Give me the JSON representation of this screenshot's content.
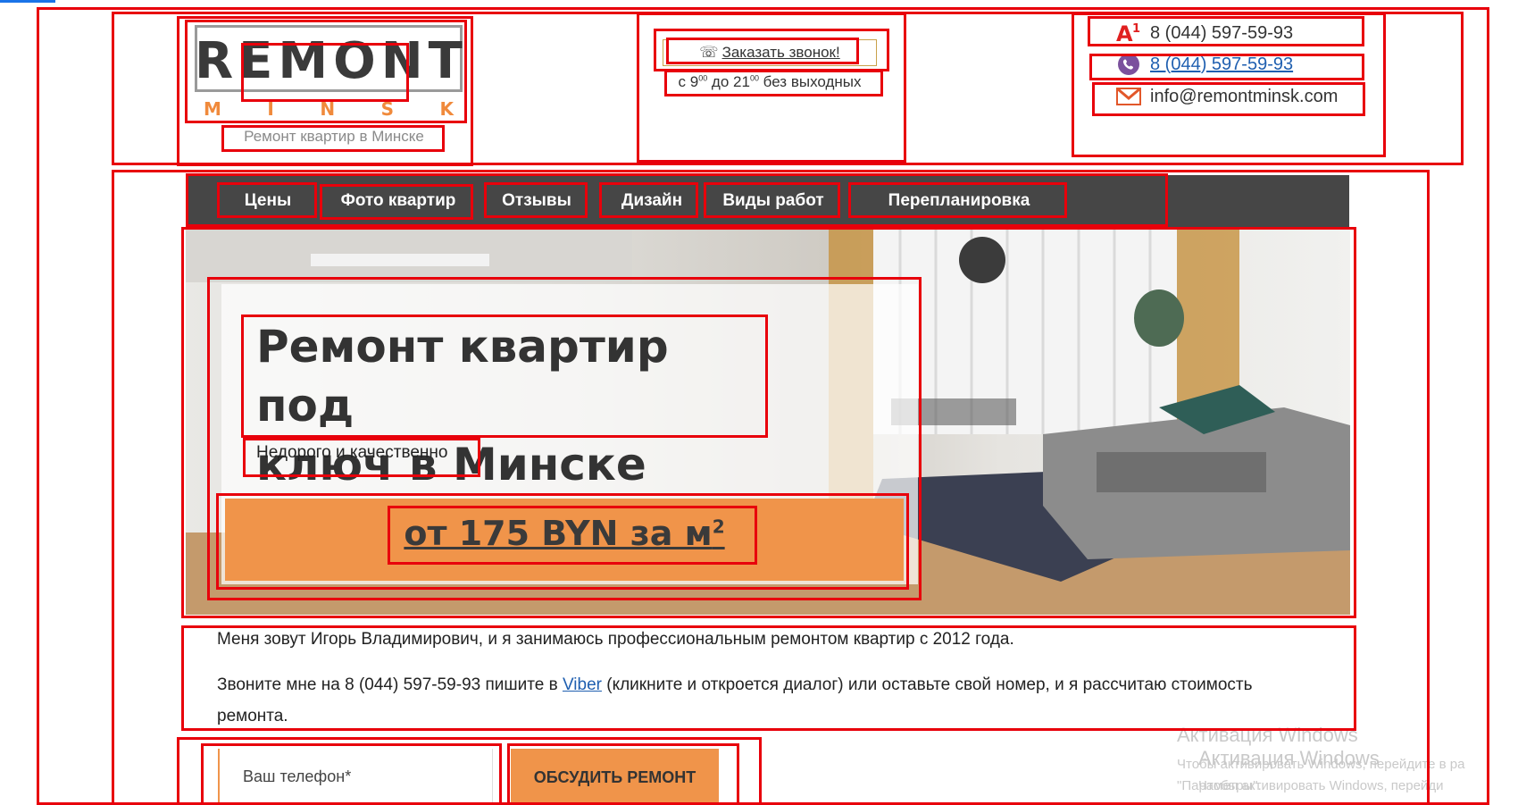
{
  "header": {
    "logo": {
      "word": "REMONT",
      "city_letters": [
        "M",
        "I",
        "N",
        "S",
        "K"
      ]
    },
    "tagline": "Ремонт квартир в Минске",
    "callback": {
      "label": "Заказать звонок!",
      "hours_prefix": "с 9",
      "hours_mid": " до 21",
      "hours_suffix": " без выходных",
      "sup": "00"
    },
    "contacts": [
      {
        "icon": "a1-operator-icon",
        "text": "8 (044) 597-59-93",
        "link": false
      },
      {
        "icon": "viber-icon",
        "text": "8 (044) 597-59-93",
        "link": true
      },
      {
        "icon": "mail-icon",
        "text": "info@remontminsk.com",
        "link": false
      }
    ]
  },
  "nav": {
    "items": [
      "Цены",
      "Фото квартир",
      "Отзывы",
      "Дизайн",
      "Виды работ",
      "Перепланировка"
    ]
  },
  "hero": {
    "title_line1": "Ремонт квартир под",
    "title_line2": "ключ в Минске",
    "subtitle": "Недорого и качественно",
    "price_main": "от 175 BYN за м",
    "price_sup": "2"
  },
  "intro": {
    "p1": "Меня зовут Игорь Владимирович, и я занимаюсь профессиональным ремонтом квартир с 2012 года.",
    "p2_before": "Звоните мне на 8 (044) 597-59-93 пишите в ",
    "p2_link": "Viber",
    "p2_after": " (кликните и откроется диалог) или оставьте свой номер, и я рассчитаю стоимость ремонта."
  },
  "form": {
    "phone_placeholder": "Ваш телефон*",
    "submit_label": "ОБСУДИТЬ РЕМОНТ"
  },
  "watermark": {
    "title_1": "Активация Windows",
    "title_2": "Активация Windows",
    "line_1": "Чтобы активировать Windows, перейдите в ра",
    "line_2": "\"Параметры\".",
    "line_3": "Чтобы активировать Windows, перейди"
  },
  "colors": {
    "accent": "#f0944a",
    "nav_bg": "#464646",
    "annotation_red": "#e8000b",
    "link": "#1f5fb0"
  }
}
